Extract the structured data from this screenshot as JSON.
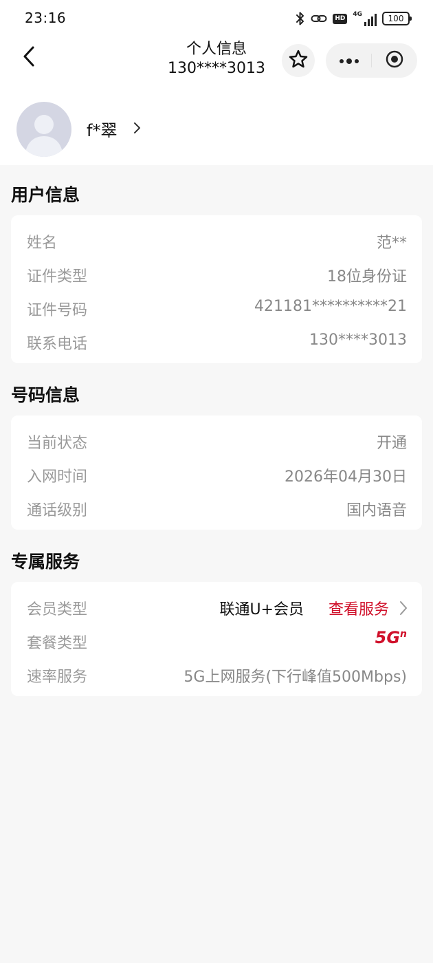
{
  "status_bar": {
    "time": "23:16",
    "network": "4G",
    "hd": "HD",
    "battery": "100",
    "icons": [
      "bluetooth-icon",
      "link-icon",
      "hd-icon",
      "signal-icon",
      "battery-icon"
    ]
  },
  "nav": {
    "title": "个人信息",
    "subtitle": "130****3013",
    "icons": [
      "back-icon",
      "star-icon",
      "more-icon",
      "target-icon"
    ]
  },
  "profile": {
    "name": "f*翠",
    "icons": [
      "avatar-icon",
      "chevron-right-icon"
    ]
  },
  "user_info": {
    "title": "用户信息",
    "rows": [
      {
        "label": "姓名",
        "value": "范**"
      },
      {
        "label": "证件类型",
        "value": "18位身份证"
      },
      {
        "label": "证件号码",
        "value": "421181**********21"
      },
      {
        "label": "联系电话",
        "value": "130****3013"
      }
    ]
  },
  "number_info": {
    "title": "号码信息",
    "rows": [
      {
        "label": "当前状态",
        "value": "开通"
      },
      {
        "label": "入网时间",
        "value": "2026年04月30日"
      },
      {
        "label": "通话级别",
        "value": "国内语音"
      }
    ]
  },
  "exclusive_service": {
    "title": "专属服务",
    "member_label": "会员类型",
    "member_value": "联通U+会员",
    "view_service": "查看服务",
    "package_label": "套餐类型",
    "package_logo": "5G",
    "package_logo_sup": "n",
    "speed_label": "速率服务",
    "speed_value": "5G上网服务(下行峰值500Mbps)"
  },
  "colors": {
    "accent": "#d0102a",
    "background": "#f7f7f7",
    "card": "#ffffff",
    "label": "#9a9a9a",
    "value": "#888888"
  }
}
